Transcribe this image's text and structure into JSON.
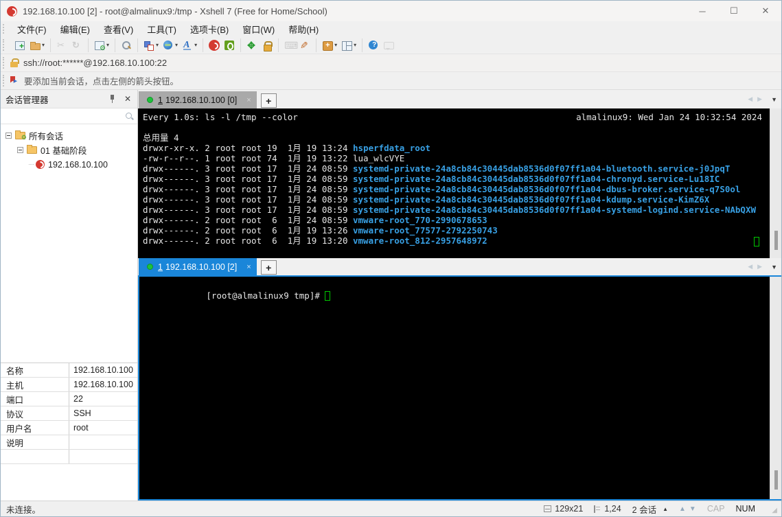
{
  "window": {
    "title": "192.168.10.100 [2] - root@almalinux9:/tmp - Xshell 7 (Free for Home/School)",
    "controls": {
      "minimize": "─",
      "maximize": "☐",
      "close": "✕"
    }
  },
  "menubar": {
    "items": [
      "文件(F)",
      "编辑(E)",
      "查看(V)",
      "工具(T)",
      "选项卡(B)",
      "窗口(W)",
      "帮助(H)"
    ]
  },
  "toolbar": {
    "groups": [
      [
        {
          "name": "new-session-icon",
          "dropdown": false,
          "disabled": false
        },
        {
          "name": "open-folder-icon",
          "dropdown": true,
          "disabled": false
        }
      ],
      [
        {
          "name": "disconnect-icon",
          "dropdown": false,
          "disabled": true
        },
        {
          "name": "reconnect-icon",
          "dropdown": false,
          "disabled": true
        }
      ],
      [
        {
          "name": "session-properties-icon",
          "dropdown": true,
          "disabled": false
        }
      ],
      [
        {
          "name": "find-icon",
          "dropdown": false,
          "disabled": false
        }
      ],
      [
        {
          "name": "color-scheme-icon",
          "dropdown": true,
          "disabled": false
        },
        {
          "name": "encoding-globe-icon",
          "dropdown": true,
          "disabled": false
        },
        {
          "name": "font-icon",
          "dropdown": true,
          "disabled": false
        }
      ],
      [
        {
          "name": "xshell-tb-icon",
          "dropdown": false,
          "disabled": false
        },
        {
          "name": "xftp-icon",
          "dropdown": false,
          "disabled": false
        }
      ],
      [
        {
          "name": "fullscreen-icon",
          "dropdown": false,
          "disabled": false
        },
        {
          "name": "lock-screen-icon",
          "dropdown": false,
          "disabled": false
        }
      ],
      [
        {
          "name": "virtual-keyboard-icon",
          "dropdown": false,
          "disabled": true
        },
        {
          "name": "highlight-pen-icon",
          "dropdown": false,
          "disabled": false
        }
      ],
      [
        {
          "name": "new-terminal-icon",
          "dropdown": true,
          "disabled": false
        },
        {
          "name": "tile-layout-icon",
          "dropdown": true,
          "disabled": false
        }
      ],
      [
        {
          "name": "help-icon",
          "dropdown": false,
          "disabled": false
        },
        {
          "name": "feedback-icon",
          "dropdown": false,
          "disabled": true
        }
      ]
    ]
  },
  "addressbar": {
    "url": "ssh://root:******@192.168.10.100:22"
  },
  "infobar": {
    "text": "要添加当前会话，点击左侧的箭头按钮。"
  },
  "session_manager": {
    "title": "会话管理器",
    "search_placeholder": "",
    "tree": [
      {
        "label": "所有会话",
        "level": 0,
        "icon": "folder-gear",
        "expander": true
      },
      {
        "label": "01 基础阶段",
        "level": 1,
        "icon": "folder",
        "expander": true
      },
      {
        "label": "192.168.10.100",
        "level": 2,
        "icon": "xshell",
        "expander": false
      }
    ]
  },
  "properties": {
    "rows": [
      {
        "label": "名称",
        "value": "192.168.10.100"
      },
      {
        "label": "主机",
        "value": "192.168.10.100"
      },
      {
        "label": "端口",
        "value": "22"
      },
      {
        "label": "协议",
        "value": "SSH"
      },
      {
        "label": "用户名",
        "value": "root"
      },
      {
        "label": "说明",
        "value": ""
      }
    ]
  },
  "tabs": {
    "pane1": {
      "num": "1",
      "label": "192.168.10.100 [0]",
      "close": "×",
      "plus": "+"
    },
    "pane2": {
      "num": "1",
      "label": "192.168.10.100 [2]",
      "close": "×",
      "plus": "+"
    }
  },
  "terminal1": {
    "header_left": "Every 1.0s: ls -l /tmp --color",
    "header_right": "almalinux9: Wed Jan 24 10:32:54 2024",
    "total": "总用量 4",
    "rows": [
      {
        "meta": "drwxr-xr-x. 2 root root 19  1月 19 13:24",
        "name": "hsperfdata_root",
        "type": "dir"
      },
      {
        "meta": "-rw-r--r--. 1 root root 74  1月 19 13:22",
        "name": "lua_wlcVYE",
        "type": "file"
      },
      {
        "meta": "drwx------. 3 root root 17  1月 24 08:59",
        "name": "systemd-private-24a8cb84c30445dab8536d0f07ff1a04-bluetooth.service-j0JpqT",
        "type": "dir"
      },
      {
        "meta": "drwx------. 3 root root 17  1月 24 08:59",
        "name": "systemd-private-24a8cb84c30445dab8536d0f07ff1a04-chronyd.service-Lu18IC",
        "type": "dir"
      },
      {
        "meta": "drwx------. 3 root root 17  1月 24 08:59",
        "name": "systemd-private-24a8cb84c30445dab8536d0f07ff1a04-dbus-broker.service-q7S0ol",
        "type": "dir"
      },
      {
        "meta": "drwx------. 3 root root 17  1月 24 08:59",
        "name": "systemd-private-24a8cb84c30445dab8536d0f07ff1a04-kdump.service-KimZ6X",
        "type": "dir"
      },
      {
        "meta": "drwx------. 3 root root 17  1月 24 08:59",
        "name": "systemd-private-24a8cb84c30445dab8536d0f07ff1a04-systemd-logind.service-NAbQXW",
        "type": "dir"
      },
      {
        "meta": "drwx------. 2 root root  6  1月 24 08:59",
        "name": "vmware-root_770-2990678653",
        "type": "dir"
      },
      {
        "meta": "drwx------. 2 root root  6  1月 19 13:26",
        "name": "vmware-root_77577-2792250743",
        "type": "dir"
      },
      {
        "meta": "drwx------. 2 root root  6  1月 19 13:20",
        "name": "vmware-root_812-2957648972",
        "type": "dir"
      }
    ]
  },
  "terminal2": {
    "prompt": "[root@almalinux9 tmp]# "
  },
  "statusbar": {
    "left": "未连接。",
    "size": "129x21",
    "cursor": "1,24",
    "sessions": "2 会话",
    "cap": "CAP",
    "num": "NUM"
  },
  "colors": {
    "accent_blue": "#1a86d9",
    "terminal_dir_blue": "#38a0e4",
    "terminal_bg": "#000000",
    "connect_green": "#1ec23b",
    "cursor_green": "#00c800",
    "xshell_red": "#d43a31"
  }
}
